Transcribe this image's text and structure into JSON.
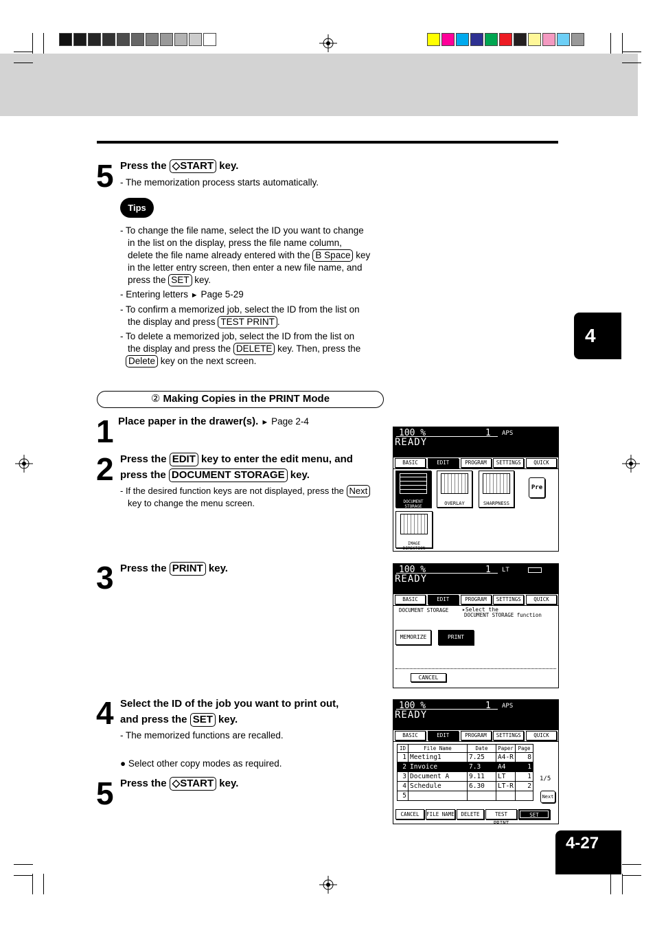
{
  "step5a": {
    "num": "5",
    "pre": "Press the ",
    "key": "◇START",
    "post": " key.",
    "note": "- The memorization process starts automatically."
  },
  "tips": {
    "label": "Tips",
    "t1a": "- To change the file name, select the ID you want to change",
    "t1b": "in the list on the display, press the file name column,",
    "t1c_pre": "delete the file name already entered with the ",
    "t1c_key": "B Space",
    "t1c_post": " key",
    "t1d": "in the letter entry screen, then enter a new file name, and",
    "t1e_pre": "press the ",
    "t1e_key": "SET",
    "t1e_post": " key.",
    "t2_pre": "- Entering letters ",
    "t2_ref": " Page 5-29",
    "t3a": "- To confirm a memorized job, select the ID from the list on",
    "t3b_pre": "the display and press ",
    "t3b_key": "TEST PRINT",
    "t3b_post": ".",
    "t4a": "- To delete a memorized job, select the ID from the list on",
    "t4b_pre": "the display and press the ",
    "t4b_key": "DELETE",
    "t4b_post": " key. Then, press the",
    "t4c_key": "Delete",
    "t4c_post": " key on the next screen."
  },
  "section": {
    "num": "②",
    "title": " Making Copies in the PRINT Mode"
  },
  "step1": {
    "num": "1",
    "head": "Place paper in the drawer(s).",
    "ref": " Page 2-4"
  },
  "step2": {
    "num": "2",
    "l1_pre": "Press the ",
    "l1_key": "EDIT",
    "l1_post": " key to enter the edit menu, and",
    "l2_pre": "press the ",
    "l2_key": "DOCUMENT STORAGE",
    "l2_post": " key.",
    "n1_pre": "- If the desired function keys are not displayed, press the ",
    "n1_key": "Next",
    "n2": "key to change the menu screen."
  },
  "step3": {
    "num": "3",
    "pre": "Press the ",
    "key": "PRINT",
    "post": " key."
  },
  "step4": {
    "num": "4",
    "l1": "Select the ID of the job you want to print out,",
    "l2_pre": "and press the ",
    "l2_key": "SET",
    "l2_post": " key.",
    "note": "- The memorized functions are recalled.",
    "bullet": "● Select other copy modes as required."
  },
  "step5b": {
    "num": "5",
    "pre": "Press the ",
    "key": "◇START",
    "post": " key."
  },
  "chapter_tab": "4",
  "page_number": "4-27",
  "screen_common": {
    "pct": "100  %",
    "count": "1",
    "ready": "READY",
    "menu": [
      "BASIC",
      "EDIT",
      "PROGRAM",
      "SETTINGS",
      "QUICK"
    ]
  },
  "screen1": {
    "size": "APS",
    "tiles": [
      "DOCUMENT STORAGE",
      "OVERLAY",
      "SHARPNESS",
      "Pre",
      "IMAGE DIRECTION"
    ]
  },
  "screen2": {
    "size": "LT",
    "label": "DOCUMENT  STORAGE",
    "hint1": "▸Select the",
    "hint2": "DOCUMENT  STORAGE  function",
    "memorize": "MEMORIZE",
    "print": "PRINT",
    "cancel": "CANCEL"
  },
  "screen3": {
    "size": "APS",
    "headers": [
      "ID",
      "File Name",
      "Date",
      "Paper",
      "Page"
    ],
    "rows": [
      [
        "1",
        "Meeting1",
        "7.25",
        "A4-R",
        "8"
      ],
      [
        "2",
        "Invoice",
        "7.3",
        "A4",
        "1"
      ],
      [
        "3",
        "Document A",
        "9.11",
        "LT",
        "1"
      ],
      [
        "4",
        "Schedule",
        "6.30",
        "LT-R",
        "2"
      ],
      [
        "5",
        "",
        "",
        "",
        ""
      ]
    ],
    "pager": "1/5",
    "next": "Next",
    "buttons": [
      "CANCEL",
      "FILE NAME",
      "DELETE",
      "TEST PRINT",
      "SET"
    ]
  },
  "colors": {
    "gray_bar": "#d3d3d3",
    "grays": [
      "#111111",
      "#1a1a1a",
      "#262626",
      "#333333",
      "#4d4d4d",
      "#666666",
      "#808080",
      "#999999",
      "#b3b3b3",
      "#cccccc",
      "#ffffff"
    ],
    "colorbar": [
      "#ffff00",
      "#ff0099",
      "#00aaee",
      "#2e3192",
      "#00a651",
      "#ed1c24",
      "#231f20",
      "#fff799",
      "#f49ac1",
      "#6dcff6",
      "#999999"
    ]
  }
}
